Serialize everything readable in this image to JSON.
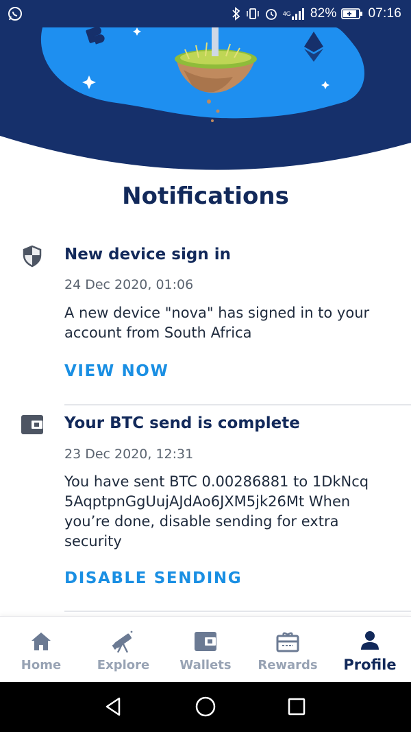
{
  "status_bar": {
    "network": "4G",
    "battery": "82%",
    "time": "07:16"
  },
  "page": {
    "title": "Notifications"
  },
  "notifications": [
    {
      "icon": "shield-icon",
      "title": "New device sign in",
      "date": "24 Dec 2020, 01:06",
      "body": "A new device \"nova\" has signed in to your account from South Africa",
      "action": "VIEW NOW"
    },
    {
      "icon": "wallet-icon",
      "title": "Your BTC send is complete",
      "date": "23 Dec 2020, 12:31",
      "body": "You have sent BTC 0.00286881 to 1DkNcq 5AqptpnGgUujAJdAo6JXM5jk26Mt When you’re done, disable sending for extra security",
      "action": "DISABLE SENDING"
    }
  ],
  "bottom_nav": {
    "items": [
      {
        "label": "Home",
        "icon": "home-icon"
      },
      {
        "label": "Explore",
        "icon": "telescope-icon"
      },
      {
        "label": "Wallets",
        "icon": "wallet-icon"
      },
      {
        "label": "Rewards",
        "icon": "gift-icon"
      },
      {
        "label": "Profile",
        "icon": "person-icon"
      }
    ],
    "active": "Profile"
  },
  "colors": {
    "navy": "#12295a",
    "accent_blue": "#1a8fe3",
    "hero_dark": "#16306b",
    "hero_light": "#1e8ff0",
    "inactive_gray": "#98a3b4"
  }
}
